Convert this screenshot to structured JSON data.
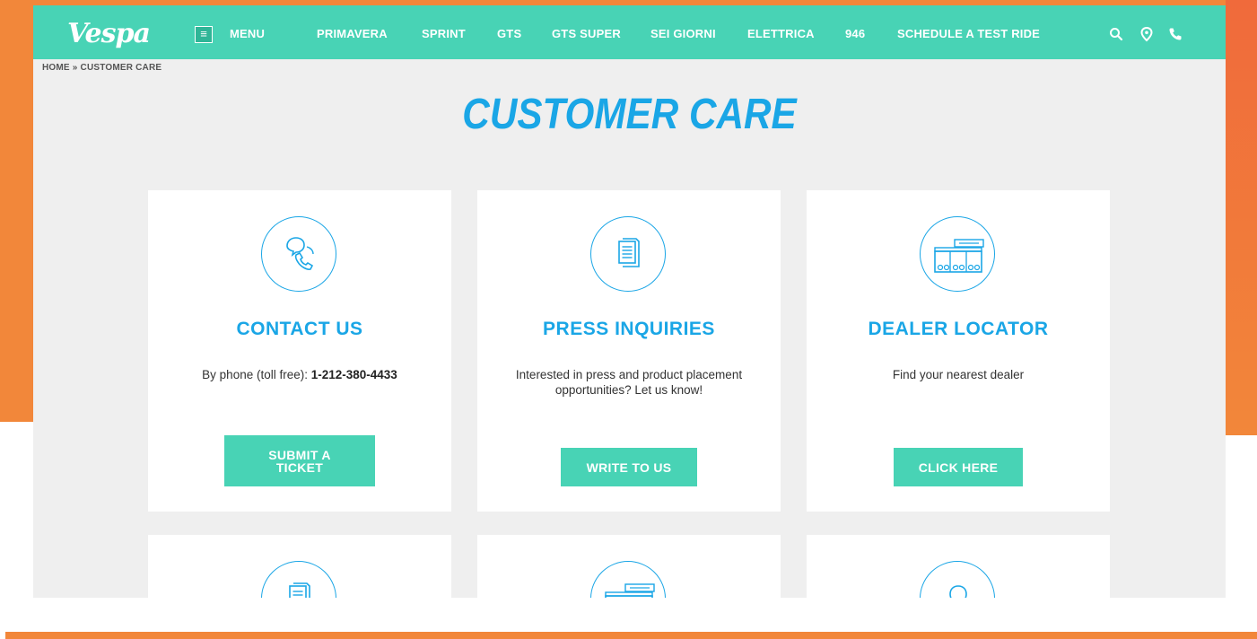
{
  "nav": {
    "logo": "Vespa",
    "menu_icon": "hamburger-icon",
    "menu_label": "MENU",
    "items": [
      "PRIMAVERA",
      "SPRINT",
      "GTS",
      "GTS SUPER",
      "SEI GIORNI",
      "ELETTRICA",
      "946",
      "SCHEDULE A TEST RIDE"
    ],
    "icons": [
      "search-icon",
      "location-pin-icon",
      "phone-icon"
    ]
  },
  "breadcrumb": "HOME » CUSTOMER CARE",
  "page_title": "CUSTOMER CARE",
  "cards": [
    {
      "icon": "phone-chat-icon",
      "title": "CONTACT US",
      "text_prefix": "By phone (toll free): ",
      "text_strong": "1-212-380-4433",
      "button": "SUBMIT A TICKET"
    },
    {
      "icon": "document-icon",
      "title": "PRESS INQUIRIES",
      "text": "Interested in press and product placement opportunities? Let us know!",
      "button": "WRITE TO US"
    },
    {
      "icon": "dealer-storefront-icon",
      "title": "DEALER LOCATOR",
      "text": "Find your nearest dealer",
      "button": "CLICK HERE"
    }
  ],
  "lower_cards": [
    {
      "icon": "document-icon"
    },
    {
      "icon": "dealer-storefront-icon"
    },
    {
      "icon": "location-pin-icon"
    }
  ],
  "colors": {
    "accent": "#48d3b5",
    "title_blue": "#1aa6e6",
    "frame_orange": "#f2873a",
    "page_bg": "#efefef"
  }
}
